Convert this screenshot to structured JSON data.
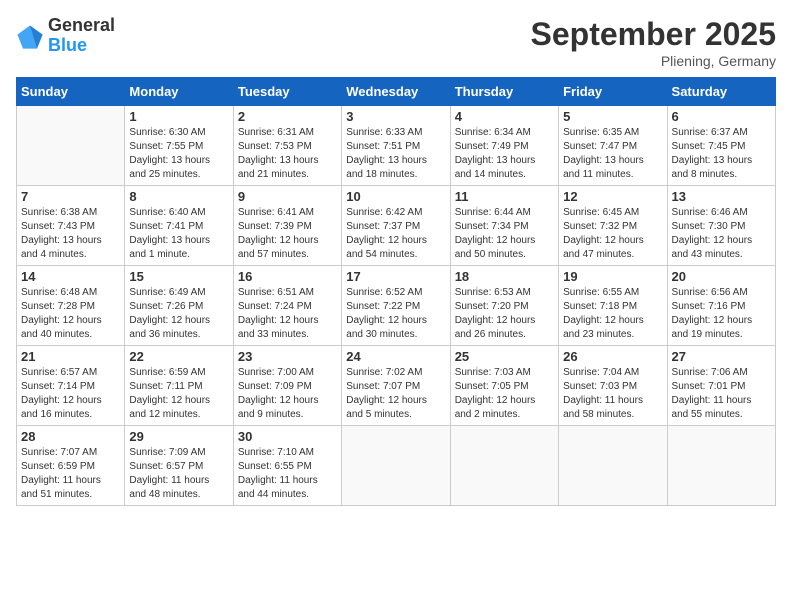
{
  "logo": {
    "general": "General",
    "blue": "Blue"
  },
  "title": {
    "month": "September 2025",
    "location": "Pliening, Germany"
  },
  "headers": [
    "Sunday",
    "Monday",
    "Tuesday",
    "Wednesday",
    "Thursday",
    "Friday",
    "Saturday"
  ],
  "weeks": [
    [
      {
        "day": "",
        "info": ""
      },
      {
        "day": "1",
        "info": "Sunrise: 6:30 AM\nSunset: 7:55 PM\nDaylight: 13 hours\nand 25 minutes."
      },
      {
        "day": "2",
        "info": "Sunrise: 6:31 AM\nSunset: 7:53 PM\nDaylight: 13 hours\nand 21 minutes."
      },
      {
        "day": "3",
        "info": "Sunrise: 6:33 AM\nSunset: 7:51 PM\nDaylight: 13 hours\nand 18 minutes."
      },
      {
        "day": "4",
        "info": "Sunrise: 6:34 AM\nSunset: 7:49 PM\nDaylight: 13 hours\nand 14 minutes."
      },
      {
        "day": "5",
        "info": "Sunrise: 6:35 AM\nSunset: 7:47 PM\nDaylight: 13 hours\nand 11 minutes."
      },
      {
        "day": "6",
        "info": "Sunrise: 6:37 AM\nSunset: 7:45 PM\nDaylight: 13 hours\nand 8 minutes."
      }
    ],
    [
      {
        "day": "7",
        "info": "Sunrise: 6:38 AM\nSunset: 7:43 PM\nDaylight: 13 hours\nand 4 minutes."
      },
      {
        "day": "8",
        "info": "Sunrise: 6:40 AM\nSunset: 7:41 PM\nDaylight: 13 hours\nand 1 minute."
      },
      {
        "day": "9",
        "info": "Sunrise: 6:41 AM\nSunset: 7:39 PM\nDaylight: 12 hours\nand 57 minutes."
      },
      {
        "day": "10",
        "info": "Sunrise: 6:42 AM\nSunset: 7:37 PM\nDaylight: 12 hours\nand 54 minutes."
      },
      {
        "day": "11",
        "info": "Sunrise: 6:44 AM\nSunset: 7:34 PM\nDaylight: 12 hours\nand 50 minutes."
      },
      {
        "day": "12",
        "info": "Sunrise: 6:45 AM\nSunset: 7:32 PM\nDaylight: 12 hours\nand 47 minutes."
      },
      {
        "day": "13",
        "info": "Sunrise: 6:46 AM\nSunset: 7:30 PM\nDaylight: 12 hours\nand 43 minutes."
      }
    ],
    [
      {
        "day": "14",
        "info": "Sunrise: 6:48 AM\nSunset: 7:28 PM\nDaylight: 12 hours\nand 40 minutes."
      },
      {
        "day": "15",
        "info": "Sunrise: 6:49 AM\nSunset: 7:26 PM\nDaylight: 12 hours\nand 36 minutes."
      },
      {
        "day": "16",
        "info": "Sunrise: 6:51 AM\nSunset: 7:24 PM\nDaylight: 12 hours\nand 33 minutes."
      },
      {
        "day": "17",
        "info": "Sunrise: 6:52 AM\nSunset: 7:22 PM\nDaylight: 12 hours\nand 30 minutes."
      },
      {
        "day": "18",
        "info": "Sunrise: 6:53 AM\nSunset: 7:20 PM\nDaylight: 12 hours\nand 26 minutes."
      },
      {
        "day": "19",
        "info": "Sunrise: 6:55 AM\nSunset: 7:18 PM\nDaylight: 12 hours\nand 23 minutes."
      },
      {
        "day": "20",
        "info": "Sunrise: 6:56 AM\nSunset: 7:16 PM\nDaylight: 12 hours\nand 19 minutes."
      }
    ],
    [
      {
        "day": "21",
        "info": "Sunrise: 6:57 AM\nSunset: 7:14 PM\nDaylight: 12 hours\nand 16 minutes."
      },
      {
        "day": "22",
        "info": "Sunrise: 6:59 AM\nSunset: 7:11 PM\nDaylight: 12 hours\nand 12 minutes."
      },
      {
        "day": "23",
        "info": "Sunrise: 7:00 AM\nSunset: 7:09 PM\nDaylight: 12 hours\nand 9 minutes."
      },
      {
        "day": "24",
        "info": "Sunrise: 7:02 AM\nSunset: 7:07 PM\nDaylight: 12 hours\nand 5 minutes."
      },
      {
        "day": "25",
        "info": "Sunrise: 7:03 AM\nSunset: 7:05 PM\nDaylight: 12 hours\nand 2 minutes."
      },
      {
        "day": "26",
        "info": "Sunrise: 7:04 AM\nSunset: 7:03 PM\nDaylight: 11 hours\nand 58 minutes."
      },
      {
        "day": "27",
        "info": "Sunrise: 7:06 AM\nSunset: 7:01 PM\nDaylight: 11 hours\nand 55 minutes."
      }
    ],
    [
      {
        "day": "28",
        "info": "Sunrise: 7:07 AM\nSunset: 6:59 PM\nDaylight: 11 hours\nand 51 minutes."
      },
      {
        "day": "29",
        "info": "Sunrise: 7:09 AM\nSunset: 6:57 PM\nDaylight: 11 hours\nand 48 minutes."
      },
      {
        "day": "30",
        "info": "Sunrise: 7:10 AM\nSunset: 6:55 PM\nDaylight: 11 hours\nand 44 minutes."
      },
      {
        "day": "",
        "info": ""
      },
      {
        "day": "",
        "info": ""
      },
      {
        "day": "",
        "info": ""
      },
      {
        "day": "",
        "info": ""
      }
    ]
  ]
}
